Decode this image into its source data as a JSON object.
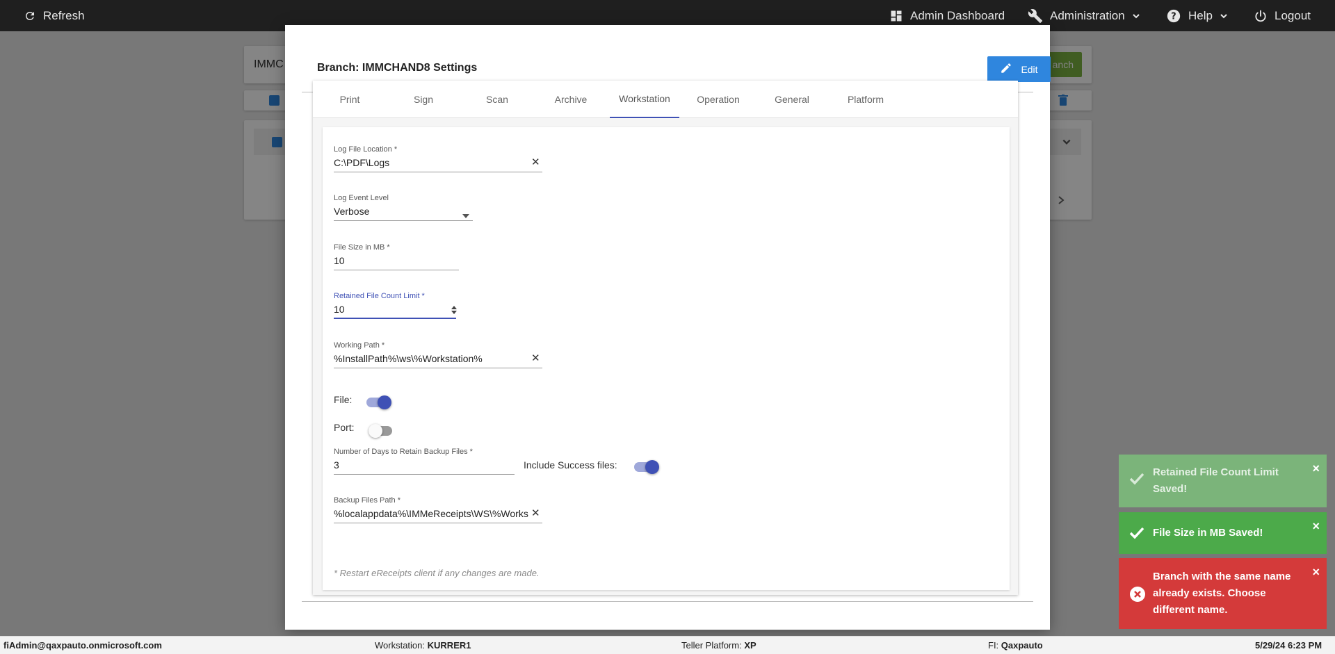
{
  "topbar": {
    "refresh": "Refresh",
    "admin_dashboard": "Admin Dashboard",
    "administration": "Administration",
    "help": "Help",
    "logout": "Logout"
  },
  "background": {
    "branch_input_value": "IMMC",
    "add_branch_button": "anch"
  },
  "modal": {
    "title": "Branch: IMMCHAND8 Settings",
    "edit_button": "Edit",
    "tabs": [
      "Print",
      "Sign",
      "Scan",
      "Archive",
      "Workstation",
      "Operation",
      "General",
      "Platform"
    ],
    "active_tab": "Workstation",
    "form": {
      "log_file_location": {
        "label": "Log File Location *",
        "value": "C:\\PDF\\Logs"
      },
      "log_event_level": {
        "label": "Log Event Level",
        "value": "Verbose"
      },
      "file_size": {
        "label": "File Size in MB *",
        "value": "10"
      },
      "retained_count": {
        "label": "Retained File Count Limit *",
        "value": "10"
      },
      "working_path": {
        "label": "Working Path *",
        "value": "%InstallPath%\\ws\\%Workstation%"
      },
      "file_toggle": {
        "label": "File:",
        "on": true
      },
      "port_toggle": {
        "label": "Port:",
        "on": false
      },
      "backup_days": {
        "label": "Number of Days to Retain Backup Files *",
        "value": "3"
      },
      "include_success": {
        "label": "Include Success files:",
        "on": true
      },
      "backup_path": {
        "label": "Backup Files Path *",
        "value": "%localappdata%\\IMMeReceipts\\WS\\%Works"
      },
      "note": "* Restart eReceipts client if any changes are made."
    }
  },
  "toasts": [
    {
      "type": "success-faded",
      "text_line1": "Retained File Count Limit",
      "text_line2": "Saved!"
    },
    {
      "type": "success",
      "text_line1": "File Size in MB Saved!"
    },
    {
      "type": "error",
      "text_line1": "Branch with the same name",
      "text_line2": "already exists. Choose",
      "text_line3": "different name."
    }
  ],
  "statusbar": {
    "user": "fiAdmin@qaxpauto.onmicrosoft.com",
    "workstation_label": "Workstation:",
    "workstation_value": "KURRER1",
    "platform_label": "Teller Platform:",
    "platform_value": "XP",
    "fi_label": "FI:",
    "fi_value": "Qaxpauto",
    "datetime": "5/29/24 6:23 PM"
  },
  "colors": {
    "topbar": "#1f1f1f",
    "primary_blue": "#2f86de",
    "accent_indigo": "#3f51b5",
    "toast_success_faded": "#7bb47a",
    "toast_success": "#4caa4a",
    "toast_error": "#d43a3a",
    "add_branch_green": "#7cb342"
  }
}
